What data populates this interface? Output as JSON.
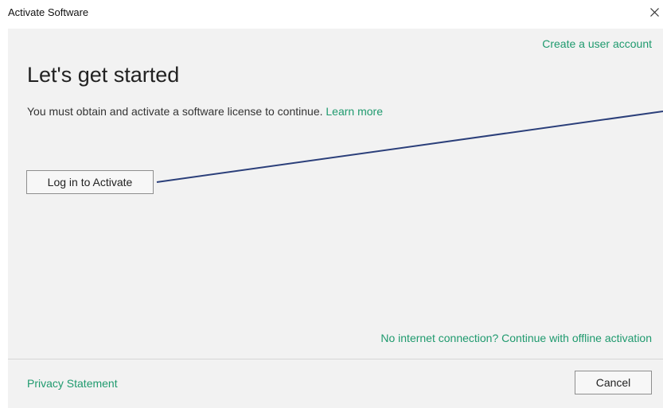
{
  "window": {
    "title": "Activate Software",
    "close_icon": "close-icon"
  },
  "header": {
    "create_account_link": "Create a user account"
  },
  "main": {
    "heading": "Let's get started",
    "description": "You must obtain and activate a software license to continue.",
    "learn_more_link": "Learn more",
    "login_button": "Log in to Activate",
    "offline_link": "No internet connection? Continue with offline activation"
  },
  "footer": {
    "privacy_link": "Privacy Statement",
    "cancel_button": "Cancel"
  },
  "colors": {
    "link": "#1f9a6e",
    "panel_background": "#f2f2f2",
    "annotation_line": "#2b3f7a"
  }
}
